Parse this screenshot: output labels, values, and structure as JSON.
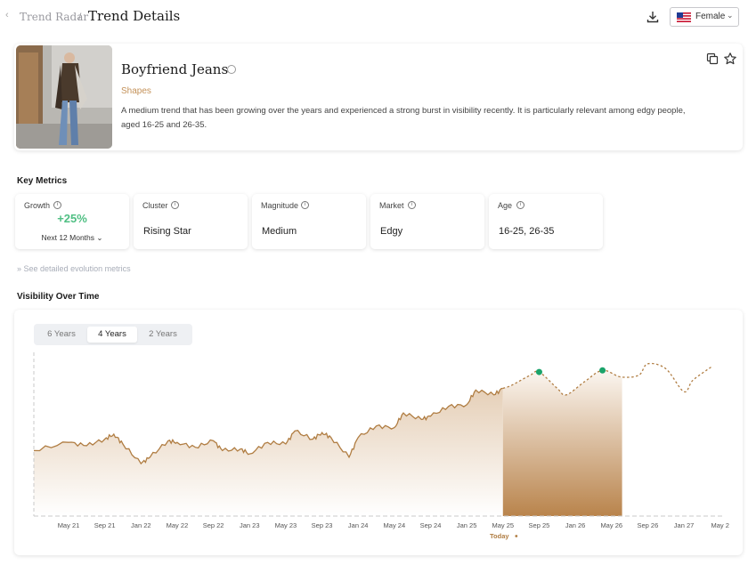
{
  "header": {
    "back_icon": "chevron-left-icon",
    "breadcrumb_root": "Trend Radar",
    "breadcrumb_sep": "/",
    "title": "Trend Details",
    "download_icon": "download-icon",
    "gender_select": {
      "value": "Female",
      "flag_icon": "us-flag-icon"
    }
  },
  "trend": {
    "name": "Boyfriend Jeans",
    "category": "Shapes",
    "description": "A medium trend that has been growing over the years and experienced a strong burst in visibility recently. It is particularly relevant among edgy people, aged 16-25 and 26-35.",
    "actions": [
      "copy-icon",
      "star-icon"
    ]
  },
  "key_metrics": {
    "title": "Key Metrics",
    "growth": {
      "label": "Growth",
      "value": "+25%",
      "period": "Next 12 Months"
    },
    "cluster": {
      "label": "Cluster",
      "value": "Rising Star"
    },
    "magnitude": {
      "label": "Magnitude",
      "value": "Medium"
    },
    "market": {
      "label": "Market",
      "value": "Edgy"
    },
    "age": {
      "label": "Age",
      "value": "16-25, 26-35"
    },
    "see_more": "See detailed evolution metrics"
  },
  "visibility": {
    "title": "Visibility Over Time",
    "tabs": [
      "6 Years",
      "4 Years",
      "2 Years"
    ],
    "active_tab": "4 Years",
    "today_label": "Today"
  },
  "colors": {
    "accent": "#b07d42",
    "growth": "#4fbf83",
    "forecast_point": "#1aa36a"
  },
  "chart_data": {
    "type": "area",
    "x_ticks": [
      "May 21",
      "Sep 21",
      "Jan 22",
      "May 22",
      "Sep 22",
      "Jan 23",
      "May 23",
      "Sep 23",
      "Jan 24",
      "May 24",
      "Sep 24",
      "Jan 25",
      "May 25",
      "Sep 25",
      "Jan 26",
      "May 26",
      "Sep 26",
      "Jan 27",
      "May 2"
    ],
    "today_index": 12,
    "historical": [
      [
        "Apr 21",
        40
      ],
      [
        "May 21",
        45
      ],
      [
        "Jul 21",
        43
      ],
      [
        "Sep 21",
        47
      ],
      [
        "Oct 21",
        50
      ],
      [
        "Nov 21",
        44
      ],
      [
        "Jan 22",
        32
      ],
      [
        "Feb 22",
        36
      ],
      [
        "Apr 22",
        46
      ],
      [
        "May 22",
        45
      ],
      [
        "Jul 22",
        42
      ],
      [
        "Sep 22",
        46
      ],
      [
        "Oct 22",
        40
      ],
      [
        "Dec 22",
        41
      ],
      [
        "Jan 23",
        38
      ],
      [
        "Mar 23",
        45
      ],
      [
        "May 23",
        44
      ],
      [
        "Jun 23",
        52
      ],
      [
        "Aug 23",
        47
      ],
      [
        "Sep 23",
        51
      ],
      [
        "Oct 23",
        48
      ],
      [
        "Dec 23",
        36
      ],
      [
        "Jan 24",
        48
      ],
      [
        "Mar 24",
        55
      ],
      [
        "May 24",
        54
      ],
      [
        "Jun 24",
        63
      ],
      [
        "Aug 24",
        59
      ],
      [
        "Sep 24",
        61
      ],
      [
        "Nov 24",
        67
      ],
      [
        "Jan 25",
        68
      ],
      [
        "Feb 25",
        77
      ],
      [
        "Apr 25",
        74
      ],
      [
        "May 25",
        78
      ]
    ],
    "forecast": [
      [
        "Jun 25",
        80
      ],
      [
        "Aug 25",
        86
      ],
      [
        "Sep 25",
        88
      ],
      [
        "Nov 25",
        78
      ],
      [
        "Dec 25",
        74
      ],
      [
        "Feb 26",
        82
      ],
      [
        "Apr 26",
        89
      ],
      [
        "Jun 26",
        85
      ],
      [
        "Aug 26",
        86
      ],
      [
        "Sep 26",
        93
      ],
      [
        "Nov 26",
        90
      ],
      [
        "Jan 27",
        76
      ],
      [
        "Feb 27",
        83
      ],
      [
        "Apr 27",
        91
      ]
    ],
    "forecast_markers": [
      "Sep 25",
      "Apr 26"
    ],
    "ylim": [
      0,
      100
    ],
    "grid": false,
    "legend": "none"
  }
}
